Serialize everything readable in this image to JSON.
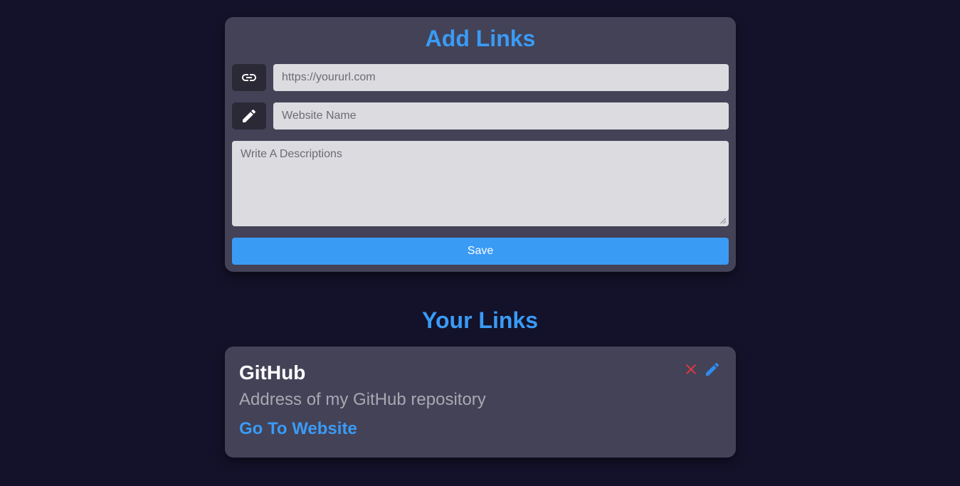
{
  "form": {
    "title": "Add Links",
    "url_placeholder": "https://yoururl.com",
    "name_placeholder": "Website Name",
    "description_placeholder": "Write A Descriptions",
    "save_label": "Save",
    "url_icon": "link-icon",
    "name_icon": "pencil-icon"
  },
  "links_section": {
    "heading": "Your Links",
    "items": [
      {
        "title": "GitHub",
        "description": "Address of my GitHub repository",
        "link_label": "Go To Website",
        "delete_icon": "close-icon",
        "edit_icon": "pencil-icon"
      }
    ]
  },
  "colors": {
    "background": "#13122a",
    "card": "#434257",
    "accent": "#3a9bf5",
    "delete": "#e0393e",
    "edit": "#2f8cf0"
  }
}
